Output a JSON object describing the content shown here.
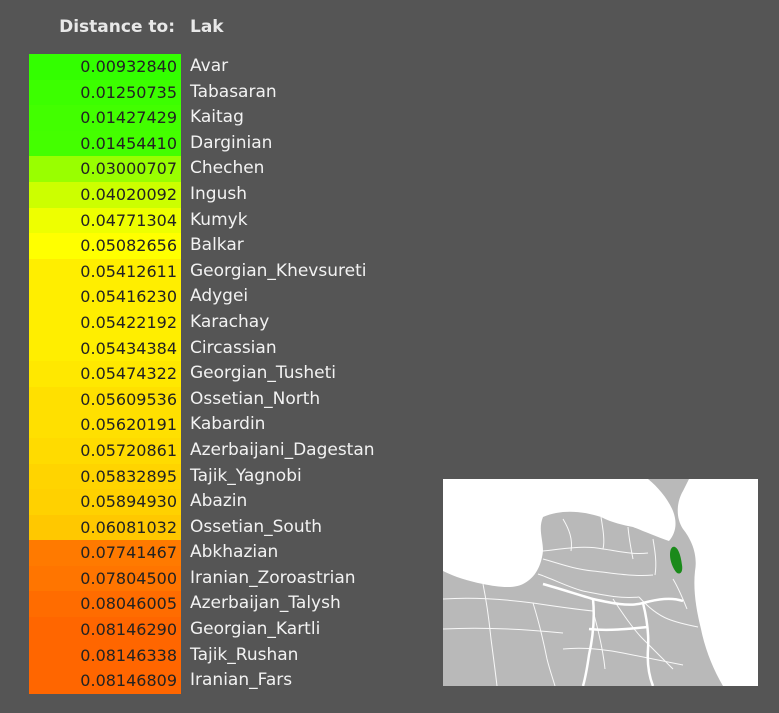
{
  "header": {
    "label": "Distance to:",
    "target": "Lak"
  },
  "chart_data": {
    "type": "table",
    "title": "Lak",
    "rows": [
      {
        "name": "Avar",
        "value": "0.00932840",
        "color": "#33ff00"
      },
      {
        "name": "Tabasaran",
        "value": "0.01250735",
        "color": "#3cff00"
      },
      {
        "name": "Kaitag",
        "value": "0.01427429",
        "color": "#42ff00"
      },
      {
        "name": "Darginian",
        "value": "0.01454410",
        "color": "#44ff00"
      },
      {
        "name": "Chechen",
        "value": "0.03000707",
        "color": "#99ff00"
      },
      {
        "name": "Ingush",
        "value": "0.04020092",
        "color": "#ccff00"
      },
      {
        "name": "Kumyk",
        "value": "0.04771304",
        "color": "#eeff00"
      },
      {
        "name": "Balkar",
        "value": "0.05082656",
        "color": "#ffff00"
      },
      {
        "name": "Georgian_Khevsureti",
        "value": "0.05412611",
        "color": "#ffee00"
      },
      {
        "name": "Adygei",
        "value": "0.05416230",
        "color": "#ffee00"
      },
      {
        "name": "Karachay",
        "value": "0.05422192",
        "color": "#ffee00"
      },
      {
        "name": "Circassian",
        "value": "0.05434384",
        "color": "#ffee00"
      },
      {
        "name": "Georgian_Tusheti",
        "value": "0.05474322",
        "color": "#ffe800"
      },
      {
        "name": "Ossetian_North",
        "value": "0.05609536",
        "color": "#ffe000"
      },
      {
        "name": "Kabardin",
        "value": "0.05620191",
        "color": "#ffe000"
      },
      {
        "name": "Azerbaijani_Dagestan",
        "value": "0.05720861",
        "color": "#ffdb00"
      },
      {
        "name": "Tajik_Yagnobi",
        "value": "0.05832895",
        "color": "#ffd400"
      },
      {
        "name": "Abazin",
        "value": "0.05894930",
        "color": "#ffd100"
      },
      {
        "name": "Ossetian_South",
        "value": "0.06081032",
        "color": "#ffc800"
      },
      {
        "name": "Abkhazian",
        "value": "0.07741467",
        "color": "#ff7a00"
      },
      {
        "name": "Iranian_Zoroastrian",
        "value": "0.07804500",
        "color": "#ff7500"
      },
      {
        "name": "Azerbaijan_Talysh",
        "value": "0.08046005",
        "color": "#ff6c00"
      },
      {
        "name": "Georgian_Kartli",
        "value": "0.08146290",
        "color": "#ff6600"
      },
      {
        "name": "Tajik_Rushan",
        "value": "0.08146338",
        "color": "#ff6600"
      },
      {
        "name": "Iranian_Fars",
        "value": "0.08146809",
        "color": "#ff6600"
      }
    ]
  },
  "map": {
    "land_color": "#b9b9b9",
    "sea_color": "#ffffff",
    "highlight_color": "#1a8a1a"
  }
}
